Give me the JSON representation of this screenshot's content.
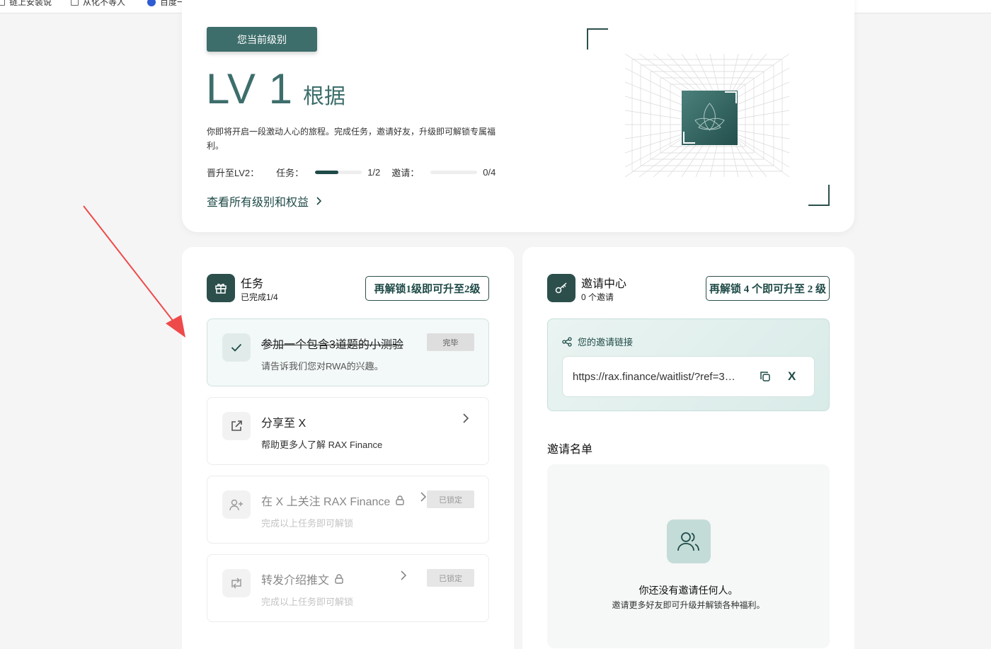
{
  "bookmarks": [
    {
      "label": "链上安装说"
    },
    {
      "label": "从化不等人"
    },
    {
      "label": "百度一下"
    }
  ],
  "level": {
    "badge_label": "您当前级别",
    "level_text": "LV 1",
    "level_sub": "根据",
    "description": "你即将开启一段激动人心的旅程。完成任务，邀请好友，升级即可解锁专属福利。",
    "promote_label": "晋升至LV2：",
    "tasks_label": "任务：",
    "tasks_value": "1/2",
    "tasks_fraction": 0.5,
    "invites_label": "邀请：",
    "invites_value": "0/4",
    "invites_fraction": 0,
    "view_link": "查看所有级别和权益"
  },
  "tasks_panel": {
    "title": "任务",
    "subtitle": "已完成1/4",
    "upgrade_button": "再解锁1级即可升至2级",
    "items": [
      {
        "title": "参加一个包含3道题的小测验",
        "subtitle": "请告诉我们您对RWA的兴趣。",
        "badge": "完毕",
        "icon": "check-icon"
      },
      {
        "title": "分享至 X",
        "subtitle": "帮助更多人了解 RAX Finance",
        "badge": "",
        "icon": "share-icon"
      },
      {
        "title": "在 X 上关注 RAX Finance",
        "subtitle": "完成以上任务即可解锁",
        "badge": "已锁定",
        "icon": "user-plus-icon"
      },
      {
        "title": "转发介绍推文",
        "subtitle": "完成以上任务即可解锁",
        "badge": "已锁定",
        "icon": "repost-icon"
      }
    ]
  },
  "invite_panel": {
    "title": "邀请中心",
    "subtitle": "0 个邀请",
    "upgrade_button": "再解锁 4 个即可升至 2 级",
    "link_label": "您的邀请链接",
    "link_value": "https://rax.finance/waitlist/?ref=3…",
    "x_label": "X",
    "list_title": "邀请名单",
    "empty_title": "你还没有邀请任何人。",
    "empty_subtitle": "邀请更多好友即可升级并解锁各种福利。"
  },
  "colors": {
    "brand": "#3d6e6b",
    "brand_dark": "#2c4f4c",
    "annotation_arrow": "#ef4a4a"
  }
}
